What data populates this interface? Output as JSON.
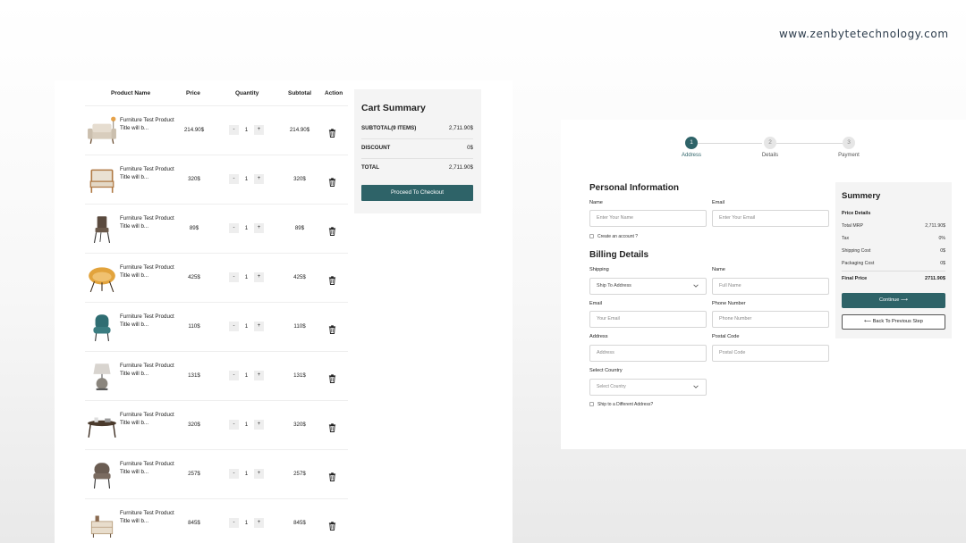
{
  "brand": {
    "url": "www.zenbytetechnology.com"
  },
  "colors": {
    "accent": "#2e6368",
    "panel_bg": "#f4f4f4"
  },
  "cart": {
    "headers": {
      "product": "Product Name",
      "price": "Price",
      "quantity": "Quantity",
      "subtotal": "Subtotal",
      "action": "Action"
    },
    "qty_minus": "-",
    "qty_plus": "+",
    "items": [
      {
        "name": "Furniture Test Product Title will b...",
        "price": "214.90$",
        "qty": "1",
        "subtotal": "214.90$",
        "icon": "armchair-icon"
      },
      {
        "name": "Furniture Test Product Title will b...",
        "price": "320$",
        "qty": "1",
        "subtotal": "320$",
        "icon": "wooden-armchair-icon"
      },
      {
        "name": "Furniture Test Product Title will b...",
        "price": "89$",
        "qty": "1",
        "subtotal": "89$",
        "icon": "dining-chair-icon"
      },
      {
        "name": "Furniture Test Product Title will b...",
        "price": "425$",
        "qty": "1",
        "subtotal": "425$",
        "icon": "papasan-chair-icon"
      },
      {
        "name": "Furniture Test Product Title will b...",
        "price": "110$",
        "qty": "1",
        "subtotal": "110$",
        "icon": "tufted-chair-icon"
      },
      {
        "name": "Furniture Test Product Title will b...",
        "price": "131$",
        "qty": "1",
        "subtotal": "131$",
        "icon": "table-lamp-icon"
      },
      {
        "name": "Furniture Test Product Title will b...",
        "price": "320$",
        "qty": "1",
        "subtotal": "320$",
        "icon": "coffee-table-icon"
      },
      {
        "name": "Furniture Test Product Title will b...",
        "price": "257$",
        "qty": "1",
        "subtotal": "257$",
        "icon": "accent-chair-icon"
      },
      {
        "name": "Furniture Test Product Title will b...",
        "price": "845$",
        "qty": "1",
        "subtotal": "845$",
        "icon": "nightstand-icon"
      }
    ]
  },
  "cart_summary": {
    "title": "Cart Summary",
    "subtotal_label": "SUBTOTAL(9 ITEMS)",
    "subtotal_value": "2,711.90$",
    "discount_label": "DISCOUNT",
    "discount_value": "0$",
    "total_label": "TOTAL",
    "total_value": "2,711.90$",
    "checkout_button": "Proceed To Checkout"
  },
  "checkout": {
    "steps": [
      {
        "number": "1",
        "label": "Address",
        "active": true
      },
      {
        "number": "2",
        "label": "Details",
        "active": false
      },
      {
        "number": "3",
        "label": "Payment",
        "active": false
      }
    ],
    "personal": {
      "title": "Personal Information",
      "name_label": "Name",
      "name_placeholder": "Enter Your Name",
      "email_label": "Email",
      "email_placeholder": "Enter Your Email",
      "create_account": "Create an account ?"
    },
    "billing": {
      "title": "Billing Details",
      "shipping_label": "Shipping",
      "shipping_value": "Ship To Address",
      "name_label": "Name",
      "name_placeholder": "Full Name",
      "email_label": "Email",
      "email_placeholder": "Your Email",
      "phone_label": "Phone Number",
      "phone_placeholder": "Phone Number",
      "address_label": "Address",
      "address_placeholder": "Address",
      "postal_label": "Postal Code",
      "postal_placeholder": "Postal Code",
      "country_label": "Select Country",
      "country_value": "Select Country",
      "ship_different": "Ship to a Different Address?"
    },
    "summery": {
      "title": "Summery",
      "price_details": "Price Details",
      "total_mrp_label": "Total MRP",
      "total_mrp_value": "2,711.90$",
      "tax_label": "Tax",
      "tax_value": "0%",
      "shipping_label": "Shipping Cost",
      "shipping_value": "0$",
      "packaging_label": "Packaging Cost",
      "packaging_value": "0$",
      "final_label": "Final Price",
      "final_value": "2711.90$",
      "continue_button": "Continue ⟶",
      "back_button": "⟵  Back To Previous Step"
    }
  }
}
